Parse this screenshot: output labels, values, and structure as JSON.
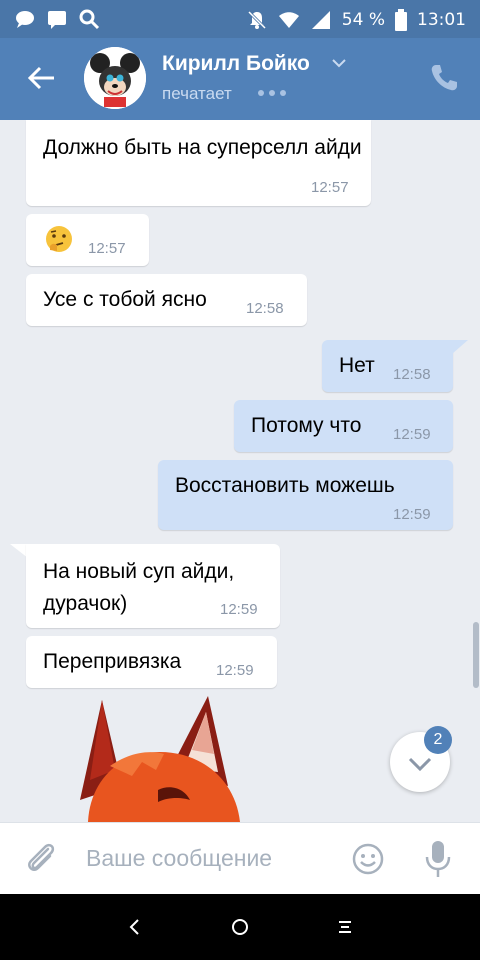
{
  "status_bar": {
    "battery": "54 %",
    "time": "13:01"
  },
  "header": {
    "name": "Кирилл Бойко",
    "status": "печатает"
  },
  "messages": [
    {
      "text": "Должно быть на суперселл айди",
      "time": "12:57",
      "dir": "in"
    },
    {
      "text": "🤔",
      "time": "12:57",
      "dir": "in"
    },
    {
      "text": "Усе с тобой ясно",
      "time": "12:58",
      "dir": "in"
    },
    {
      "text": "Нет",
      "time": "12:58",
      "dir": "out"
    },
    {
      "text": "Потому что",
      "time": "12:59",
      "dir": "out"
    },
    {
      "text": "Восстановить можешь",
      "time": "12:59",
      "dir": "out"
    },
    {
      "text": "На новый суп айди, дурачок)",
      "time": "12:59",
      "dir": "in"
    },
    {
      "text": "Перепривязка",
      "time": "12:59",
      "dir": "in"
    }
  ],
  "scroll_badge": "2",
  "input": {
    "placeholder": "Ваше сообщение"
  },
  "colors": {
    "header": "#5181b8",
    "status_bar": "#4a76a8",
    "outgoing_bubble": "#cfe0f7",
    "background": "#eaedf2"
  }
}
